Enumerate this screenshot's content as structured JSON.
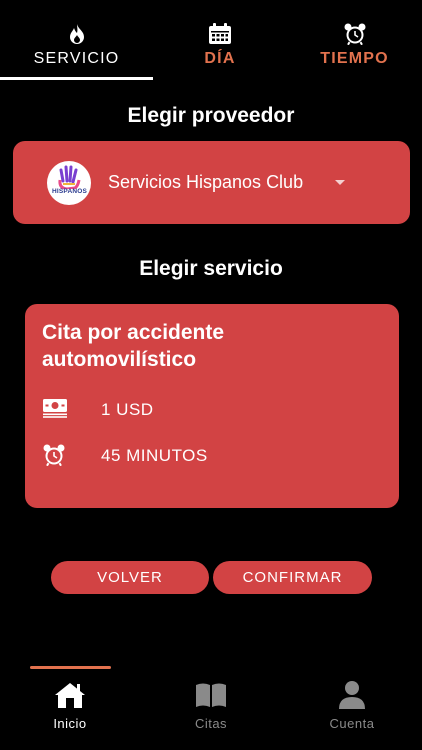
{
  "tabs": [
    {
      "label": "SERVICIO",
      "icon": "flame-icon",
      "active": true
    },
    {
      "label": "DÍA",
      "icon": "calendar-icon",
      "active": false
    },
    {
      "label": "TIEMPO",
      "icon": "alarm-clock-icon",
      "active": false
    }
  ],
  "provider_section": {
    "heading": "Elegir proveedor",
    "selected_provider": "Servicios Hispanos Club",
    "logo_text": "HISPANOS"
  },
  "service_section": {
    "heading": "Elegir servicio",
    "service": {
      "title": "Cita por accidente automovilístico",
      "price": "1 USD",
      "duration": "45 MINUTOS"
    }
  },
  "buttons": {
    "back": "VOLVER",
    "confirm": "CONFIRMAR"
  },
  "bottom_nav": [
    {
      "label": "Inicio",
      "icon": "home-icon",
      "active": true
    },
    {
      "label": "Citas",
      "icon": "book-icon",
      "active": false
    },
    {
      "label": "Cuenta",
      "icon": "user-icon",
      "active": false
    }
  ],
  "colors": {
    "background": "#000000",
    "card": "#d24344",
    "accent": "#e2724e",
    "inactive": "#8a8a8a"
  }
}
